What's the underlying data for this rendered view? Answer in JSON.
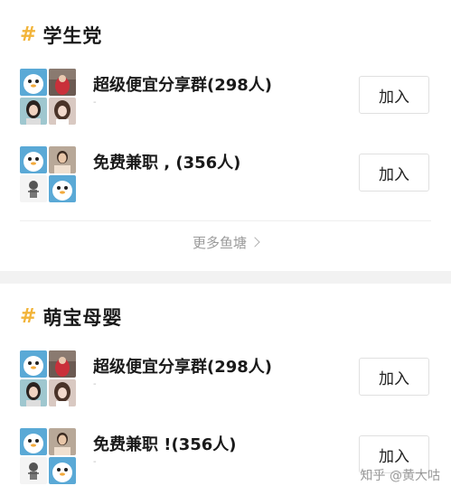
{
  "sections": [
    {
      "title": "学生党",
      "groups": [
        {
          "name": "超级便宜分享群(298人)",
          "sub": "-",
          "join_label": "加入"
        },
        {
          "name": "免费兼职 ,    (356人)",
          "sub": "",
          "join_label": "加入"
        }
      ],
      "more_label": "更多鱼塘"
    },
    {
      "title": "萌宝母婴",
      "groups": [
        {
          "name": "超级便宜分享群(298人)",
          "sub": "-",
          "join_label": "加入"
        },
        {
          "name": "免费兼职      !(356人)",
          "sub": "-",
          "join_label": "加入"
        }
      ]
    }
  ],
  "watermark": "知乎 @黄大咕",
  "colors": {
    "accent_hash": "#f2b43a",
    "section_gap": "#f2f2f2",
    "button_border": "#e0e0e0"
  }
}
